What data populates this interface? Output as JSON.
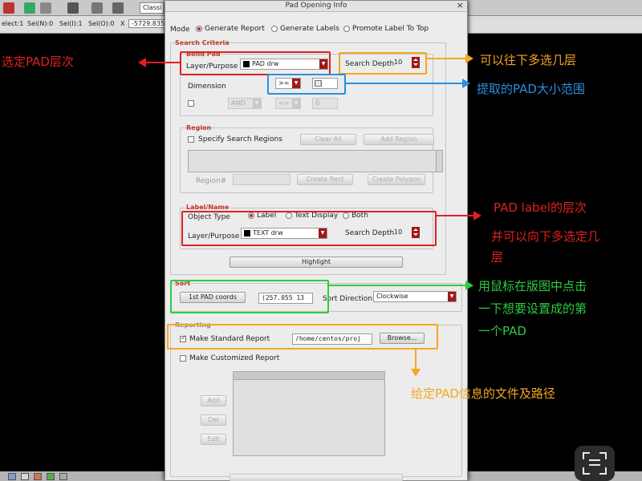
{
  "background_app": {
    "toolbar": {
      "classname_field": "Classi"
    },
    "statusbar": {
      "items": [
        "elect:1",
        "Sel(N):0",
        "Sel(I):1",
        "Sel(O):0"
      ],
      "x_label": "X",
      "coord_value": "-5729.835"
    }
  },
  "dialog": {
    "title": "Pad Opening Info",
    "close_glyph": "×",
    "mode": {
      "label": "Mode",
      "options": [
        "Generate Report",
        "Generate Labels",
        "Promote Label To Top"
      ],
      "selected": "Generate Report"
    },
    "search_criteria": {
      "title": "Search Criteria",
      "bond_pad": {
        "title": "Bond Pad",
        "layer_label": "Layer/Purpose",
        "layer_value": "PAD drw",
        "layer_color": "#000000",
        "search_depth_label": "Search Depth",
        "search_depth_value": "10",
        "dimension_label": "Dimension",
        "dimension_op": ">=",
        "dimension_value": "",
        "and_label": "AND",
        "and_op": "<=",
        "and_value": "0"
      },
      "region": {
        "title": "Region",
        "specify_label": "Specify Search Regions",
        "clear_all": "Clear All",
        "add_region": "Add Region",
        "region_label": "Region#",
        "create_rect": "Create Rect",
        "create_polygon": "Create Polygon"
      },
      "label_name": {
        "title": "Label/Name",
        "object_type_label": "Object Type",
        "object_type_options": [
          "Label",
          "Text Display",
          "Both"
        ],
        "object_type_selected": "Label",
        "layer_label": "Layer/Purpose",
        "layer_value": "TEXT drw",
        "layer_color": "#000000",
        "search_depth_label": "Search Depth",
        "search_depth_value": "10"
      },
      "highlight_button": "Highlight"
    },
    "sort": {
      "title": "Sort",
      "first_pad_button": "1st PAD coords",
      "coords_value": "(257.055 13",
      "direction_label": "Sort Direction",
      "direction_value": "Clockwise"
    },
    "reporting": {
      "title": "Reporting",
      "standard_label": "Make Standard Report",
      "standard_checked": true,
      "path_value": "/home/centos/proj",
      "browse_button": "Browse...",
      "customized_label": "Make Customized Report",
      "customized_checked": false,
      "side_buttons": [
        "Add",
        "Del",
        "Edit"
      ]
    }
  },
  "annotations": {
    "bond_pad_layer": {
      "text": "选定PAD层次",
      "color": "#e02020"
    },
    "search_depth": {
      "text": "可以往下多选几层",
      "color": "#f5a623"
    },
    "dimension": {
      "text": "提取的PAD大小范围",
      "color": "#2b8fe0"
    },
    "label_layer": {
      "text_line1": "PAD label的层次",
      "text_line2": "并可以向下多选定几",
      "text_line3": "层",
      "color": "#e02020"
    },
    "sort": {
      "text_line1": "用鼠标在版图中点击",
      "text_line2": "一下想要设置成的第",
      "text_line3": "一个PAD",
      "color": "#2ecc40"
    },
    "report": {
      "text": "给定PAD信息的文件及路径",
      "color": "#f5a623"
    }
  }
}
